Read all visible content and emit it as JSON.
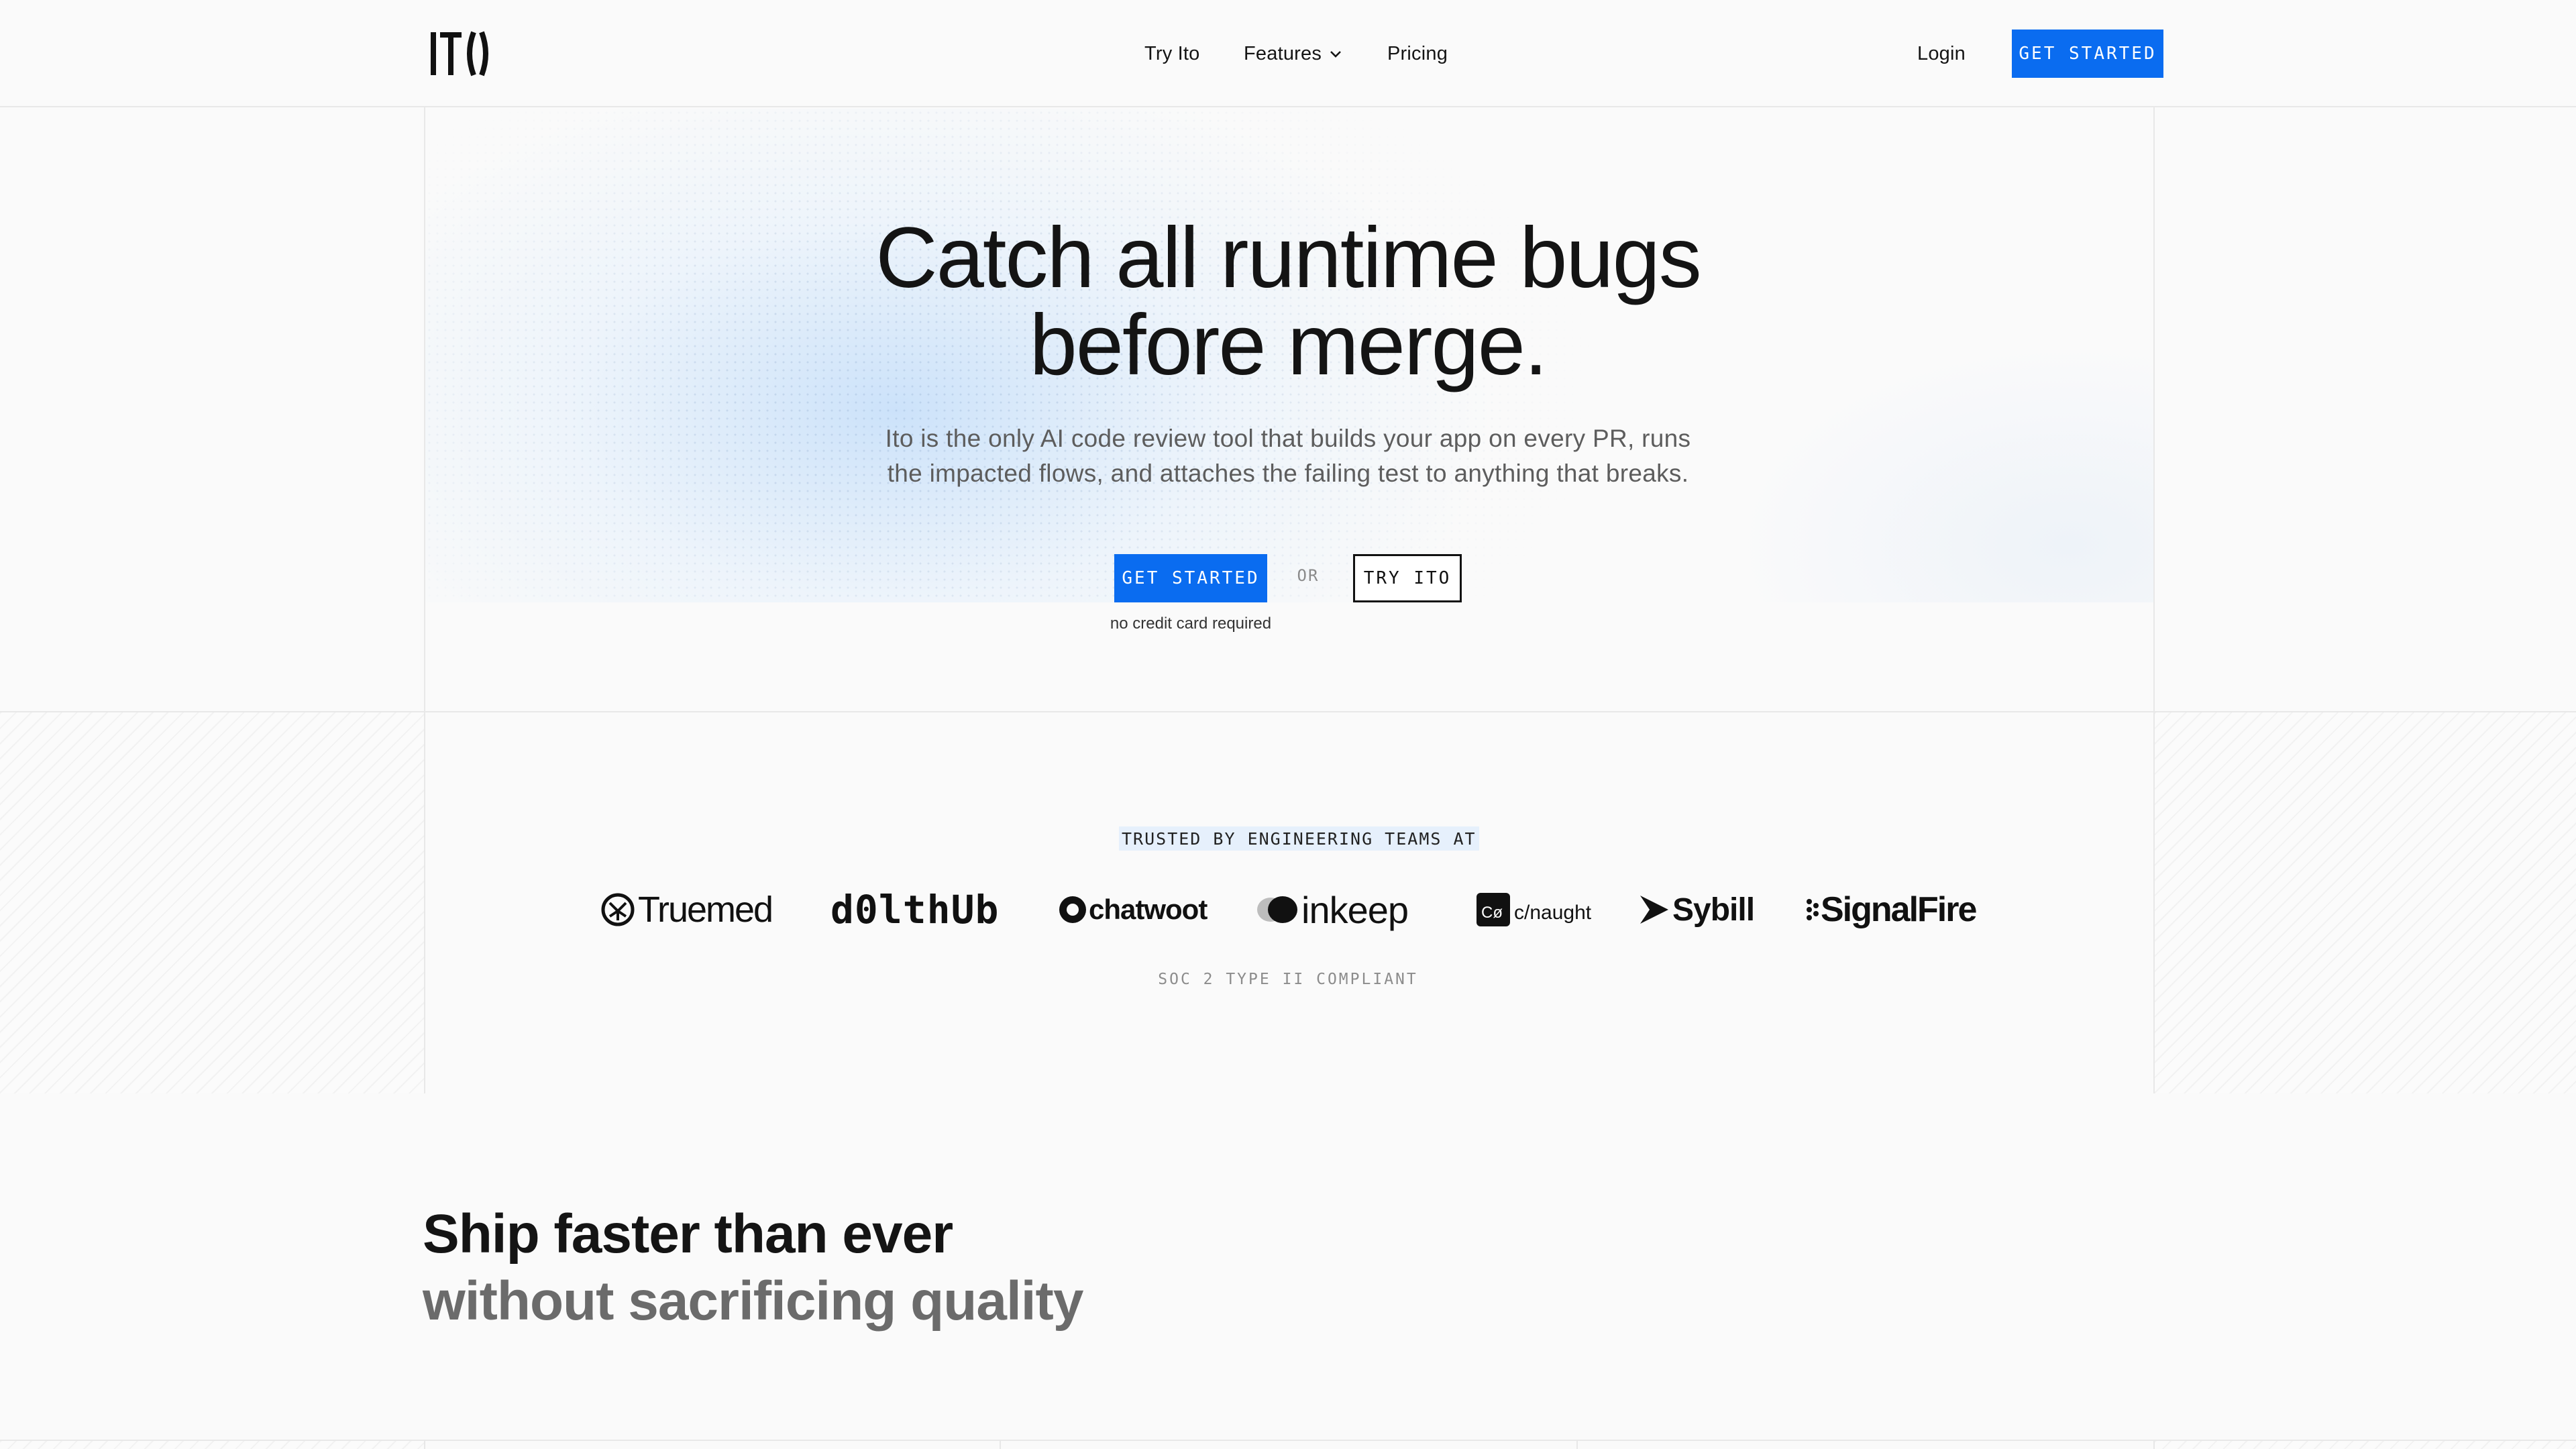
{
  "header": {
    "logo_text": "ITO",
    "nav": {
      "try": "Try Ito",
      "features": "Features",
      "pricing": "Pricing"
    },
    "login": "Login",
    "cta": "GET STARTED"
  },
  "hero": {
    "title_line1": "Catch all runtime bugs",
    "title_line2": "before merge.",
    "subtitle_line1": "Ito is the only AI code review tool that builds your app on every PR, runs",
    "subtitle_line2": "the impacted flows, and attaches the failing test to anything that breaks.",
    "primary_cta": "GET STARTED",
    "or": "OR",
    "secondary_cta": "TRY ITO",
    "note": "no credit card required"
  },
  "trusted": {
    "label": "TRUSTED BY ENGINEERING TEAMS AT",
    "logos": [
      "Truemed",
      "d0lthUb",
      "chatwoot",
      "inkeep",
      "c/naught",
      "Sybill",
      "SignalFire"
    ],
    "compliance": "SOC 2 TYPE II COMPLIANT"
  },
  "ship": {
    "line1": "Ship faster than ever",
    "line2": "without sacrificing quality"
  },
  "colors": {
    "accent": "#0a6cf0",
    "text": "#141414",
    "muted": "#5d5d5d",
    "background": "#fafafa",
    "border": "#e8e8e8"
  }
}
